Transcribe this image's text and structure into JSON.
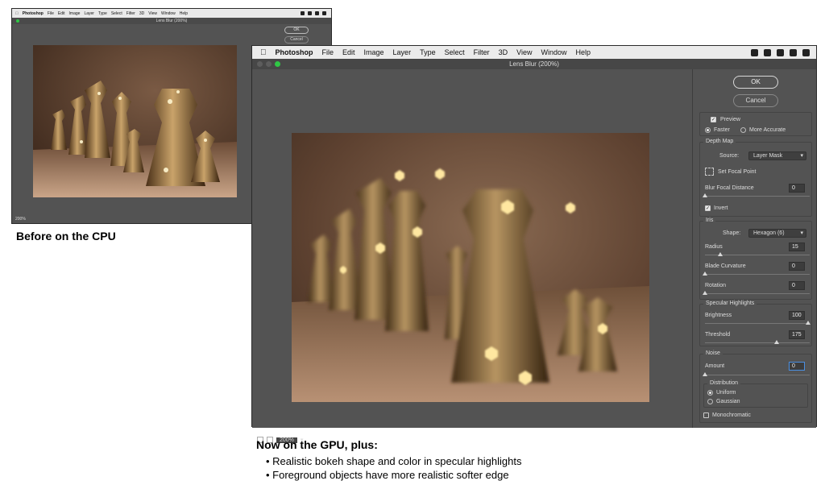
{
  "small_window": {
    "menu": [
      "Photoshop",
      "File",
      "Edit",
      "Image",
      "Layer",
      "Type",
      "Select",
      "Filter",
      "3D",
      "View",
      "Window",
      "Help"
    ],
    "title": "Lens Blur (200%)",
    "ok_label": "OK",
    "cancel_label": "Cancel",
    "zoom": "200%"
  },
  "captions": {
    "before": "Before on the CPU",
    "after": "Now on the GPU, plus:",
    "bullets": [
      "Realistic bokeh shape and color in specular highlights",
      "Foreground objects have more realistic softer edge"
    ]
  },
  "big_window": {
    "apple_icon": "apple-icon",
    "menu": [
      "Photoshop",
      "File",
      "Edit",
      "Image",
      "Layer",
      "Type",
      "Select",
      "Filter",
      "3D",
      "View",
      "Window",
      "Help"
    ],
    "title": "Lens Blur (200%)",
    "zoom": "200%"
  },
  "panel": {
    "ok_label": "OK",
    "cancel_label": "Cancel",
    "preview": {
      "label": "Preview",
      "checked": true
    },
    "quality": {
      "options": [
        "Faster",
        "More Accurate"
      ],
      "selected": "Faster"
    },
    "depth_map": {
      "title": "Depth Map",
      "source_label": "Source:",
      "source_value": "Layer Mask",
      "set_focal_point": "Set Focal Point",
      "blur_focal_distance_label": "Blur Focal Distance",
      "blur_focal_distance": "0",
      "invert_label": "Invert",
      "invert_checked": true
    },
    "iris": {
      "title": "Iris",
      "shape_label": "Shape:",
      "shape_value": "Hexagon (6)",
      "radius_label": "Radius",
      "radius": "15",
      "blade_curvature_label": "Blade Curvature",
      "blade_curvature": "0",
      "rotation_label": "Rotation",
      "rotation": "0"
    },
    "specular": {
      "title": "Specular Highlights",
      "brightness_label": "Brightness",
      "brightness": "100",
      "threshold_label": "Threshold",
      "threshold": "175"
    },
    "noise": {
      "title": "Noise",
      "amount_label": "Amount",
      "amount": "0",
      "distribution_title": "Distribution",
      "distribution_options": [
        "Uniform",
        "Gaussian"
      ],
      "distribution_selected": "Uniform",
      "monochromatic_label": "Monochromatic",
      "monochromatic_checked": false
    }
  },
  "colors": {
    "panel_bg": "#535353",
    "accent_focus": "#4a8fe2",
    "traffic_green": "#2fc745"
  }
}
